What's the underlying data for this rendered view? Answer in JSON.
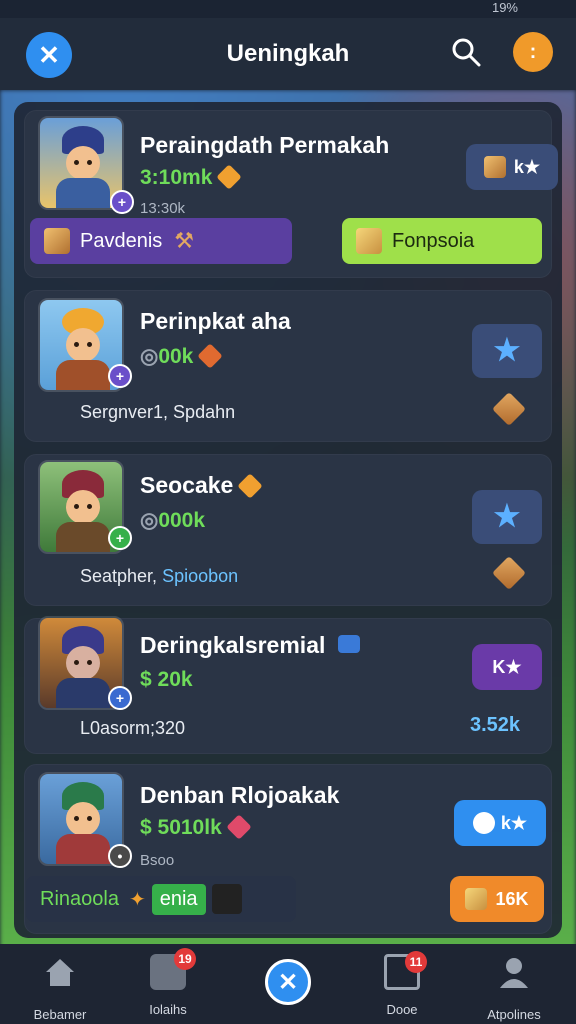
{
  "status": {
    "text": "19%"
  },
  "header": {
    "title": "Ueningkah",
    "close": "✕",
    "menu": ":"
  },
  "cards": [
    {
      "name": "Peraingdath Permakah",
      "price": "3:10mk",
      "sub": "13:30k",
      "side_label": "k★",
      "pill_left": "Pavdenis",
      "pill_right": "Fonpsoia"
    },
    {
      "name": "Perinpkat aha",
      "price": "00k",
      "sub": "Sergnver1, Spdahn"
    },
    {
      "name": "Seocake",
      "price": "000k",
      "sub_a": "Seatpher, ",
      "sub_b": "Spioobon"
    },
    {
      "name": "Deringkalsremial",
      "price": "$ 20k",
      "sub": "L0asorm;320",
      "side_label": "K★",
      "side_value": "3.52k"
    },
    {
      "name": "Denban Rlojoakak",
      "price": "$ 5010lk",
      "sub": "Bsoo",
      "side_label": "k★",
      "pill_left": "Rinaoola",
      "pill_mid": "enia",
      "side_bottom": "16K"
    }
  ],
  "nav": {
    "items": [
      {
        "label": "Bebamer",
        "badge": ""
      },
      {
        "label": "Iolaihs",
        "badge": "19"
      },
      {
        "label": "Dooe",
        "badge": "11"
      },
      {
        "label": "Atpolines",
        "badge": ""
      }
    ],
    "center": "✕"
  },
  "colors": {
    "accent_blue": "#2f8ff0",
    "accent_orange": "#f09a2a",
    "price_green": "#6fdc5a",
    "purple": "#5a3fa0",
    "lime": "#9fe04a"
  }
}
